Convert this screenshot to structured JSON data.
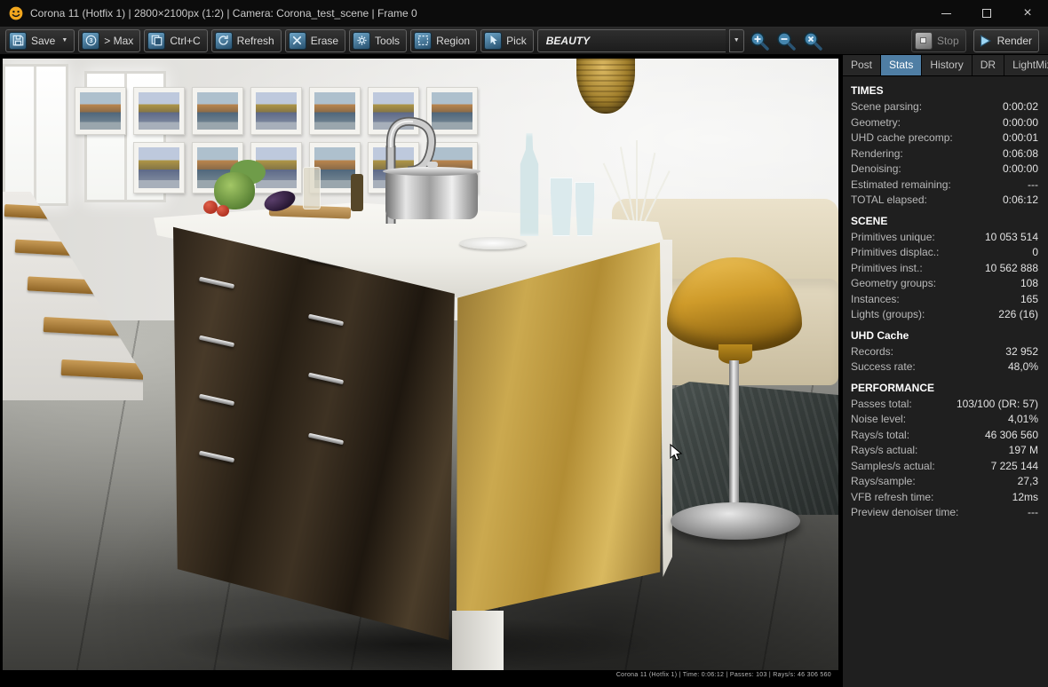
{
  "window": {
    "title": "Corona 11 (Hotfix 1) | 2800×2100px (1:2) | Camera: Corona_test_scene | Frame 0"
  },
  "toolbar": {
    "buttons": [
      {
        "id": "save",
        "label": "Save"
      },
      {
        "id": "to-max",
        "label": "> Max"
      },
      {
        "id": "copy",
        "label": "Ctrl+C"
      },
      {
        "id": "refresh",
        "label": "Refresh"
      },
      {
        "id": "erase",
        "label": "Erase"
      },
      {
        "id": "tools",
        "label": "Tools"
      },
      {
        "id": "region",
        "label": "Region"
      },
      {
        "id": "pick",
        "label": "Pick"
      }
    ],
    "render_element": "BEAUTY",
    "stop_label": "Stop",
    "render_label": "Render"
  },
  "panel": {
    "tabs": [
      {
        "label": "Post",
        "active": false
      },
      {
        "label": "Stats",
        "active": true
      },
      {
        "label": "History",
        "active": false
      },
      {
        "label": "DR",
        "active": false
      },
      {
        "label": "LightMix",
        "active": false
      }
    ],
    "sections": [
      {
        "title": "TIMES",
        "rows": [
          {
            "label": "Scene parsing:",
            "value": "0:00:02"
          },
          {
            "label": "Geometry:",
            "value": "0:00:00"
          },
          {
            "label": "UHD cache precomp:",
            "value": "0:00:01"
          },
          {
            "label": "Rendering:",
            "value": "0:06:08"
          },
          {
            "label": "Denoising:",
            "value": "0:00:00"
          },
          {
            "label": "Estimated remaining:",
            "value": "---"
          },
          {
            "label": "TOTAL elapsed:",
            "value": "0:06:12"
          }
        ]
      },
      {
        "title": "SCENE",
        "rows": [
          {
            "label": "Primitives unique:",
            "value": "10 053 514"
          },
          {
            "label": "Primitives displac.:",
            "value": "0"
          },
          {
            "label": "Primitives inst.:",
            "value": "10 562 888"
          },
          {
            "label": "Geometry groups:",
            "value": "108"
          },
          {
            "label": "Instances:",
            "value": "165"
          },
          {
            "label": "Lights (groups):",
            "value": "226 (16)"
          }
        ]
      },
      {
        "title": "UHD Cache",
        "rows": [
          {
            "label": "Records:",
            "value": "32 952"
          },
          {
            "label": "Success rate:",
            "value": "48,0%"
          }
        ]
      },
      {
        "title": "PERFORMANCE",
        "rows": [
          {
            "label": "Passes total:",
            "value": "103/100 (DR: 57)"
          },
          {
            "label": "Noise level:",
            "value": "4,01%"
          },
          {
            "label": "Rays/s total:",
            "value": "46 306 560"
          },
          {
            "label": "Rays/s actual:",
            "value": "197 M"
          },
          {
            "label": "Samples/s actual:",
            "value": "7 225 144"
          },
          {
            "label": "Rays/sample:",
            "value": "27,3"
          },
          {
            "label": "VFB refresh time:",
            "value": "12ms"
          },
          {
            "label": "Preview denoiser time:",
            "value": "---"
          }
        ]
      }
    ]
  },
  "image": {
    "stamp": "Corona 11 (Hotfix 1) | Time: 0:06:12 | Passes: 103 | Rays/s: 46 306 560"
  },
  "colors": {
    "accent": "#4f7ea4",
    "icon_blue": "#3f7da5",
    "stool_gold": "#cf9b2a",
    "cabinet_gold": "#b28d34",
    "cabinet_dark": "#3a2f21"
  }
}
